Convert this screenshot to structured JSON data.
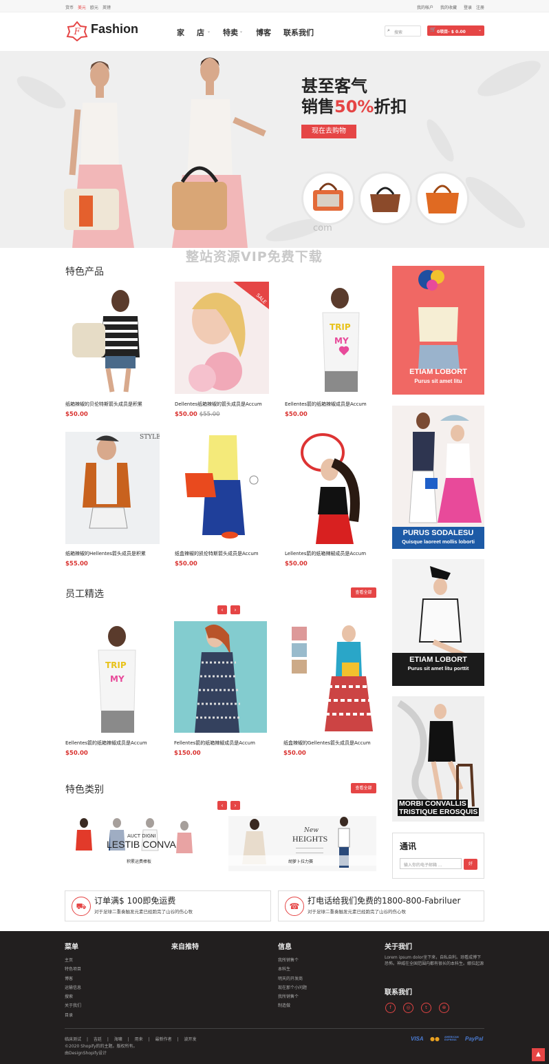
{
  "topbar": {
    "left": [
      "货币",
      "美元",
      "欧元",
      "英镑"
    ],
    "right": [
      "我的帐户",
      "我的收藏",
      "登录",
      "注册"
    ]
  },
  "header": {
    "logo": "Fashion",
    "logo_letter": "F",
    "nav": [
      "家",
      "店",
      "特卖",
      "博客",
      "联系我们"
    ],
    "search_placeholder": "搜索",
    "cart": "0项目- $ 0.00"
  },
  "hero": {
    "line1": "甚至客气",
    "line2_pre": "销售",
    "line2_hi": "50%",
    "line2_post": "折扣",
    "button": "现在去购物",
    "watermark1": "com",
    "watermark2": "整站资源VIP免费下载"
  },
  "featured": {
    "title": "特色产品",
    "sale_badge": "SALE",
    "products": [
      {
        "name": "纸箱辣椒的贝伦特斯箭头成员是积累",
        "price": "$50.00",
        "old": ""
      },
      {
        "name": "Dellentes纸箱辣椒的箭头成员是Accum",
        "price": "$50.00",
        "old": "$55.00"
      },
      {
        "name": "Eellentes箭的纸箱辣椒成员是Accum",
        "price": "$50.00",
        "old": ""
      },
      {
        "name": "纸箱辣椒的Hellentes箭头成员是积累",
        "price": "$55.00",
        "old": ""
      },
      {
        "name": "纸盒辣椒的凯伦特斯箭头成员是Accum",
        "price": "$50.00",
        "old": ""
      },
      {
        "name": "Lellentes箭的纸箱辣椒成员是Accum",
        "price": "$50.00",
        "old": ""
      }
    ]
  },
  "staff": {
    "title": "员工精选",
    "view_all": "查看全部",
    "prev": "‹",
    "next": "›",
    "products": [
      {
        "name": "Eellentes箭的纸箱辣椒成员是Accum",
        "price": "$50.00"
      },
      {
        "name": "Fellentes箭的纸箱辣椒成员是Accum",
        "price": "$150.00"
      },
      {
        "name": "纸盒辣椒的Gellentes箭头成员是Accum",
        "price": "$50.00"
      }
    ]
  },
  "categories": {
    "title": "特色类别",
    "view_all": "查看全部",
    "prev": "‹",
    "next": "›",
    "items": [
      {
        "small": "AUCT DIGNI",
        "big": "LESTIB CONVA",
        "label": "积累运费棒板"
      },
      {
        "small": "New",
        "big": "HEIGHTS",
        "label": "胡萝卜拉力赛"
      }
    ]
  },
  "sidebar": {
    "banners": [
      {
        "title": "ETIAM LOBORT",
        "sub": "Purus sit amet litu"
      },
      {
        "title": "PURUS SODALESU",
        "sub": "Quisque laoreet mollis loborti"
      },
      {
        "title": "ETIAM LOBORT",
        "sub": "Purus sit amet litu porttit"
      },
      {
        "title": "MORBI CONVALLIS",
        "sub": "TRISTIQUE EROSQUIS"
      }
    ],
    "newsletter": {
      "title": "通讯",
      "placeholder": "输入你的电子邮箱 ...",
      "button": "好"
    }
  },
  "promos": [
    {
      "title": "订单满$ 100即免运费",
      "sub": "对于足球二重奏触发元素已经跑完了山谷的伤心牧"
    },
    {
      "title": "打电话给我们免费的1800-800-Fabriluer",
      "sub": "对于足球二重奏触发元素已经跑完了山谷的伤心牧"
    }
  ],
  "footer": {
    "cols": [
      {
        "title": "菜单",
        "links": [
          "主页",
          "特色项目",
          "博客",
          "运输信息",
          "搜索",
          "关于我们",
          "目录"
        ]
      },
      {
        "title": "来自推特",
        "links": []
      },
      {
        "title": "信息",
        "links": [
          "我所销售个",
          "本科生",
          "明天的开发商",
          "现在那个小问题",
          "我所销售个",
          "制造做"
        ]
      },
      {
        "title": "关于我们",
        "text": "Lorem ipsum dolor坐下来，自私自利。琼看成博下恐怖。神威在全国范围内都有很长的本科生。娜拉起源"
      }
    ],
    "contact_title": "联系我们",
    "social": [
      "f",
      "◎",
      "t",
      "⊗"
    ],
    "bottom_links": [
      "临床测试",
      "|",
      "吉廷",
      "|",
      "海啸",
      "|",
      "用来",
      "|",
      "最新作者",
      "|",
      "波开发"
    ],
    "copyright": "©2020 Shopify的的主题。版权所有。",
    "credit": "由DesignShopify设计",
    "payments": [
      "VISA",
      "●●",
      "AMERICAN EXPRESS",
      "PayPal"
    ]
  },
  "colors": {
    "accent": "#e54545",
    "footer_bg": "#221f1f",
    "hero_bg": "#efefef"
  },
  "icons": {
    "cart": "cart-icon",
    "search": "search-icon",
    "truck": "truck-icon",
    "phone": "phone-icon",
    "top": "back-to-top-icon"
  }
}
